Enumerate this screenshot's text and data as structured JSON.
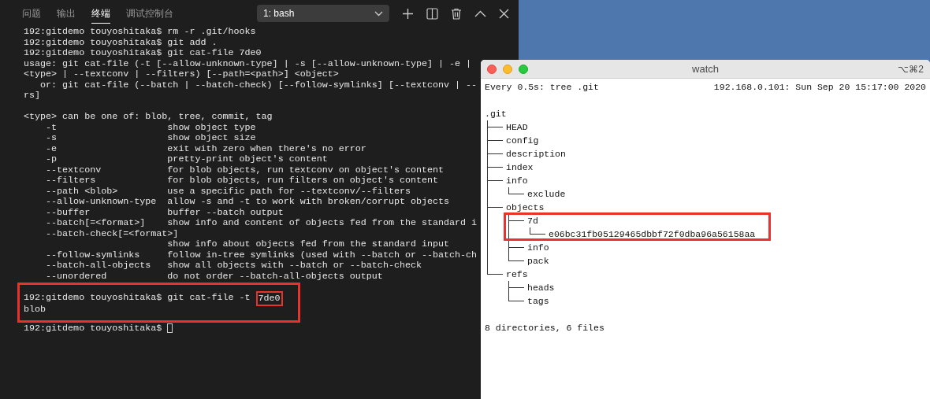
{
  "terminal_panel": {
    "tabs": [
      {
        "label": "问题",
        "selected": false
      },
      {
        "label": "输出",
        "selected": false
      },
      {
        "label": "终端",
        "selected": true
      },
      {
        "label": "调试控制台",
        "selected": false
      }
    ],
    "shell_dropdown": "1: bash",
    "output_blocks": [
      [
        "192:gitdemo touyoshitaka$ rm -r .git/hooks",
        "192:gitdemo touyoshitaka$ git add .",
        "192:gitdemo touyoshitaka$ git cat-file 7de0",
        "usage: git cat-file (-t [--allow-unknown-type] | -s [--allow-unknown-type] | -e |",
        "<type> | --textconv | --filters) [--path=<path>] <object>",
        "   or: git cat-file (--batch | --batch-check) [--follow-symlinks] [--textconv | --",
        "rs]"
      ],
      [
        "<type> can be one of: blob, tree, commit, tag",
        "    -t                    show object type",
        "    -s                    show object size",
        "    -e                    exit with zero when there's no error",
        "    -p                    pretty-print object's content",
        "    --textconv            for blob objects, run textconv on object's content",
        "    --filters             for blob objects, run filters on object's content",
        "    --path <blob>         use a specific path for --textconv/--filters",
        "    --allow-unknown-type  allow -s and -t to work with broken/corrupt objects",
        "    --buffer              buffer --batch output",
        "    --batch[=<format>]    show info and content of objects fed from the standard i",
        "    --batch-check[=<format>]",
        "                          show info about objects fed from the standard input",
        "    --follow-symlinks     follow in-tree symlinks (used with --batch or --batch-ch",
        "    --batch-all-objects   show all objects with --batch or --batch-check",
        "    --unordered           do not order --batch-all-objects output"
      ]
    ],
    "highlighted_block": [
      {
        "parts": [
          {
            "text": "192:gitdemo touyoshitaka$ git cat-file -t ",
            "boxed": false
          },
          {
            "text": "7de0",
            "boxed": true
          }
        ]
      },
      {
        "parts": [
          {
            "text": "blob",
            "boxed": false
          }
        ]
      }
    ],
    "prompt": "192:gitdemo touyoshitaka$"
  },
  "watch_window": {
    "title": "watch",
    "shortcut": "⌥⌘2",
    "command": "Every 0.5s: tree .git",
    "host_time": "192.168.0.101: Sun Sep 20 15:17:00 2020",
    "tree": {
      "name": ".git",
      "children": [
        {
          "name": "HEAD"
        },
        {
          "name": "config"
        },
        {
          "name": "description"
        },
        {
          "name": "index"
        },
        {
          "name": "info",
          "children": [
            {
              "name": "exclude"
            }
          ]
        },
        {
          "name": "objects",
          "children": [
            {
              "name": "7d",
              "highlighted": true,
              "children": [
                {
                  "name": "e06bc31fb05129465dbbf72f0dba96a56158aa"
                }
              ]
            },
            {
              "name": "info"
            },
            {
              "name": "pack"
            }
          ]
        },
        {
          "name": "refs",
          "children": [
            {
              "name": "heads"
            },
            {
              "name": "tags"
            }
          ]
        }
      ]
    },
    "summary": "8 directories, 6 files"
  }
}
